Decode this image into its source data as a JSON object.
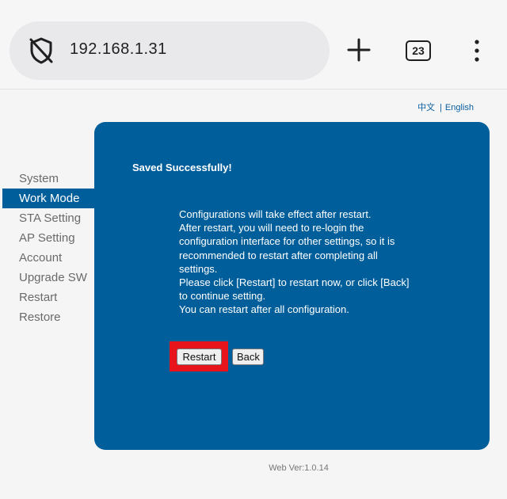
{
  "browser": {
    "url": "192.168.1.31",
    "tab_count": "23",
    "icons": {
      "security": "shield-slash-icon",
      "new_tab": "plus-icon",
      "menu": "kebab-menu-icon"
    }
  },
  "language": {
    "chinese": "中文",
    "separator": "|",
    "english": "English"
  },
  "sidebar": {
    "items": [
      {
        "label": "System"
      },
      {
        "label": "Work Mode",
        "active": true
      },
      {
        "label": "STA Setting"
      },
      {
        "label": "AP Setting"
      },
      {
        "label": "Account"
      },
      {
        "label": "Upgrade SW"
      },
      {
        "label": "Restart"
      },
      {
        "label": "Restore"
      }
    ]
  },
  "panel": {
    "title": "Saved Successfully!",
    "lines": [
      "Configurations will take effect after restart.",
      "After restart, you will need to re-login the configuration interface for other settings, so it is recommended to restart after completing all settings.",
      "Please click [Restart] to restart now, or click [Back] to continue setting.",
      "You can restart after all configuration."
    ],
    "restart_label": "Restart",
    "back_label": "Back"
  },
  "footer": {
    "version": "Web Ver:1.0.14"
  },
  "colors": {
    "panel": "#005e9a",
    "highlight": "#e8141c",
    "link": "#0a5fa0"
  }
}
